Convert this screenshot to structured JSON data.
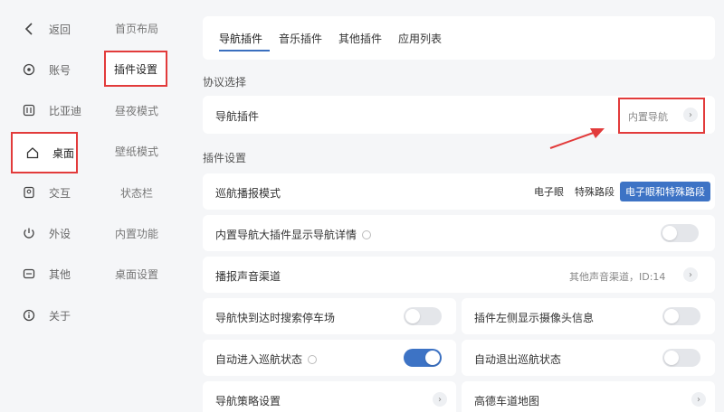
{
  "nav_primary": [
    {
      "label": "返回",
      "icon": "back-icon"
    },
    {
      "label": "账号",
      "icon": "account-icon"
    },
    {
      "label": "比亚迪",
      "icon": "byd-icon"
    },
    {
      "label": "桌面",
      "icon": "home-icon"
    },
    {
      "label": "交互",
      "icon": "interact-icon"
    },
    {
      "label": "外设",
      "icon": "peripheral-icon"
    },
    {
      "label": "其他",
      "icon": "other-icon"
    },
    {
      "label": "关于",
      "icon": "about-icon"
    }
  ],
  "nav_secondary": [
    "首页布局",
    "插件设置",
    "昼夜模式",
    "壁纸模式",
    "状态栏",
    "内置功能",
    "桌面设置"
  ],
  "tabs": [
    "导航插件",
    "音乐插件",
    "其他插件",
    "应用列表"
  ],
  "protocol": {
    "section": "协议选择",
    "label": "导航插件",
    "value": "内置导航"
  },
  "plugin_settings": {
    "section": "插件设置",
    "cruise_mode": {
      "label": "巡航播报模式",
      "options": [
        "电子眼",
        "特殊路段",
        "电子眼和特殊路段"
      ],
      "selected": 2
    },
    "show_detail": {
      "label": "内置导航大插件显示导航详情",
      "on": false
    },
    "audio_channel": {
      "label": "播报声音渠道",
      "value": "其他声音渠道，ID:14"
    },
    "search_parking": {
      "label": "导航快到达时搜索停车场",
      "on": false
    },
    "camera_info": {
      "label": "插件左侧显示摄像头信息",
      "on": false
    },
    "auto_cruise_enter": {
      "label": "自动进入巡航状态",
      "on": true
    },
    "auto_cruise_exit": {
      "label": "自动退出巡航状态",
      "on": false
    },
    "nav_strategy": {
      "label": "导航策略设置"
    },
    "lane_map": {
      "label": "高德车道地图"
    }
  },
  "colors": {
    "accent": "#3d73c5",
    "highlight": "#e23b3b"
  }
}
